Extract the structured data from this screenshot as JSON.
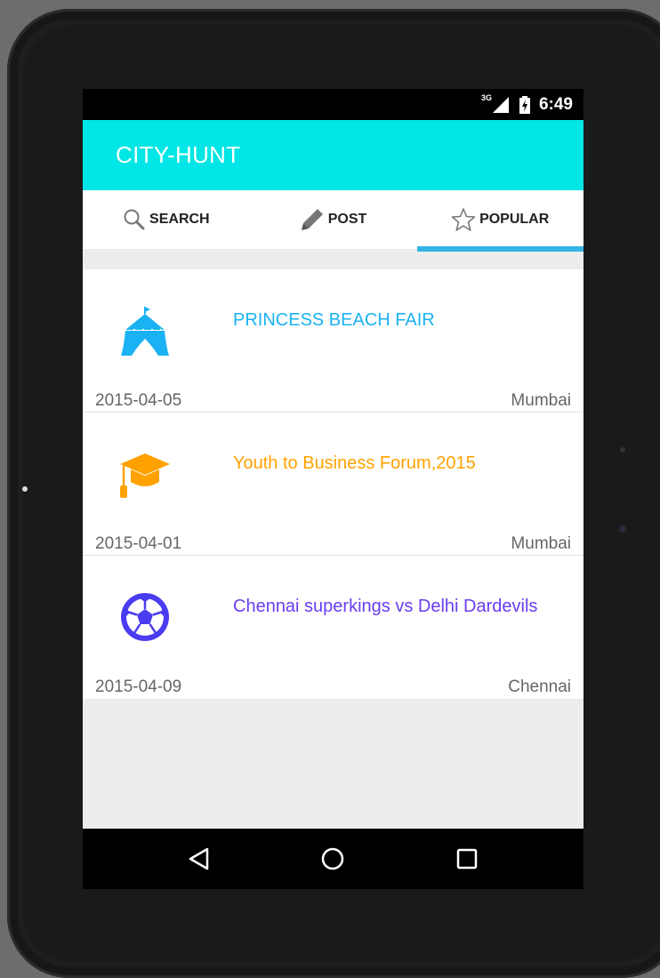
{
  "status_bar": {
    "network": "3G",
    "time": "6:49"
  },
  "app_bar": {
    "title": "CITY-HUNT"
  },
  "tabs": [
    {
      "label": "SEARCH",
      "icon": "search-icon"
    },
    {
      "label": "POST",
      "icon": "pencil-icon"
    },
    {
      "label": "POPULAR",
      "icon": "star-icon",
      "selected": true
    }
  ],
  "events": [
    {
      "name": "PRINCESS BEACH FAIR",
      "date": "2015-04-05",
      "city": "Mumbai",
      "icon": "tent-icon",
      "color": "#1ab2f2"
    },
    {
      "name": "Youth to Business Forum,2015",
      "date": "2015-04-01",
      "city": "Mumbai",
      "icon": "graduation-cap-icon",
      "color": "#ffa200"
    },
    {
      "name": "Chennai superkings vs Delhi Dardevils",
      "date": "2015-04-09",
      "city": "Chennai",
      "icon": "soccer-ball-icon",
      "color": "#6a3df0"
    }
  ],
  "nav": [
    "back-icon",
    "home-icon",
    "recents-icon"
  ],
  "colors": {
    "app_bar": "#00e5e5",
    "tab_indicator": "#33b5e5"
  }
}
